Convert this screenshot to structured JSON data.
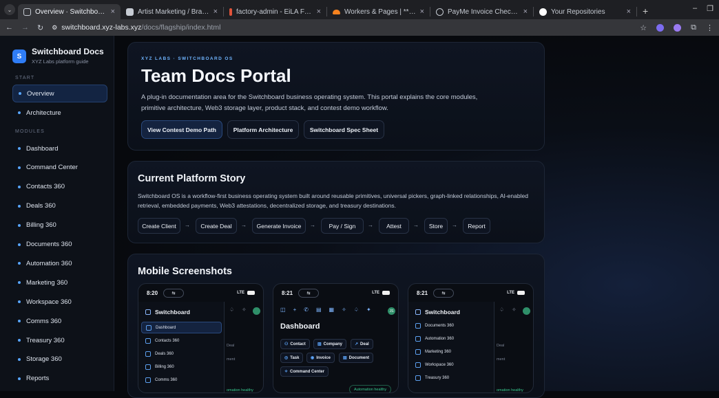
{
  "browser": {
    "tabs": [
      {
        "title": "Overview · Switchboard Docs",
        "active": true,
        "icon_color": "#58a6ff"
      },
      {
        "title": "Artist Marketing / Branding - X",
        "active": false,
        "icon_color": "#9aa0aa"
      },
      {
        "title": "factory-admin - EiLA Factory F",
        "active": false,
        "icon_color": "#e0533a"
      },
      {
        "title": "Workers & Pages | *** .xyz Lab",
        "active": false,
        "icon_color": "#f6821f"
      },
      {
        "title": "PayMe Invoice Checkout",
        "active": false,
        "icon_color": "#c6cbd3"
      },
      {
        "title": "Your Repositories",
        "active": false,
        "icon_color": "#ffffff"
      }
    ],
    "url_host": "switchboard.xyz-labs.xyz",
    "url_path": "/docs/flagship/index.html"
  },
  "sidebar": {
    "brand_initial": "S",
    "brand_title": "Switchboard Docs",
    "brand_subtitle": "XYZ Labs platform guide",
    "start_label": "START",
    "start_items": [
      "Overview",
      "Architecture"
    ],
    "modules_label": "MODULES",
    "module_items": [
      "Dashboard",
      "Command Center",
      "Contacts 360",
      "Deals 360",
      "Billing 360",
      "Documents 360",
      "Automation 360",
      "Marketing 360",
      "Workspace 360",
      "Comms 360",
      "Treasury 360",
      "Storage 360",
      "Reports"
    ],
    "active_item": "Overview"
  },
  "hero": {
    "eyebrow": "XYZ LABS · SWITCHBOARD OS",
    "title": "Team Docs Portal",
    "description": "A plug-in documentation area for the Switchboard business operating system. This portal explains the core modules, primitive architecture, Web3 storage layer, product stack, and contest demo workflow.",
    "buttons": [
      "View Contest Demo Path",
      "Platform Architecture",
      "Switchboard Spec Sheet"
    ]
  },
  "story": {
    "title": "Current Platform Story",
    "description": "Switchboard OS is a workflow-first business operating system built around reusable primitives, universal pickers, graph-linked relationships, AI-enabled retrieval, embedded payments, Web3 attestations, decentralized storage, and treasury destinations.",
    "flow": [
      "Create Client",
      "Create Deal",
      "Generate Invoice",
      "Pay / Sign",
      "Attest",
      "Store",
      "Report"
    ],
    "arrow": "→"
  },
  "screenshots": {
    "title": "Mobile Screenshots",
    "phones": [
      {
        "time": "8:20",
        "network": "LTE",
        "app": "Switchboard",
        "items": [
          "Dashboard",
          "Contacts 360",
          "Deals 360",
          "Billing 360",
          "Comms 360"
        ],
        "ghost_texts": [
          "Deal",
          "ment",
          "omation healthy"
        ]
      },
      {
        "time": "8:21",
        "network": "LTE",
        "page_title": "Dashboard",
        "chips": [
          "Contact",
          "Company",
          "Deal",
          "Task",
          "Invoice",
          "Document",
          "Command Center"
        ],
        "badge": "Automation healthy",
        "avatar": "JS"
      },
      {
        "time": "8:21",
        "network": "LTE",
        "app": "Switchboard",
        "items": [
          "Documents 360",
          "Automation 360",
          "Marketing 360",
          "Workspace 360",
          "Treasury 360"
        ],
        "ghost_texts": [
          "Deal",
          "ment",
          "omation healthy"
        ]
      }
    ]
  }
}
